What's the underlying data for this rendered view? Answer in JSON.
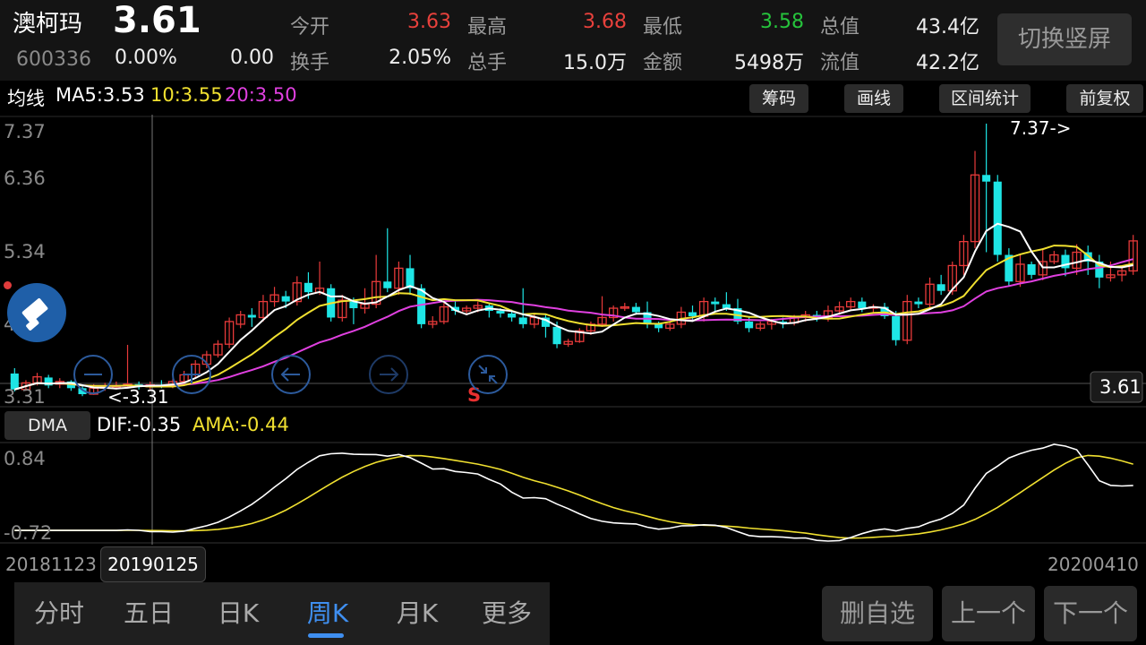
{
  "stock": {
    "name": "澳柯玛",
    "code": "600336",
    "price": "3.61",
    "change_pct": "0.00%",
    "change": "0.00"
  },
  "fields": [
    {
      "label": "今开",
      "value": "3.63",
      "color": "#e8413c"
    },
    {
      "label": "最高",
      "value": "3.68",
      "color": "#e8413c"
    },
    {
      "label": "最低",
      "value": "3.58",
      "color": "#26c43c"
    },
    {
      "label": "总值",
      "value": "43.4亿",
      "color": "#eeeeee"
    },
    {
      "label": "换手",
      "value": "2.05%",
      "color": "#eeeeee"
    },
    {
      "label": "总手",
      "value": "15.0万",
      "color": "#eeeeee"
    },
    {
      "label": "金额",
      "value": "5498万",
      "color": "#eeeeee"
    },
    {
      "label": "流值",
      "value": "42.2亿",
      "color": "#eeeeee"
    }
  ],
  "switch_label": "切换竖屏",
  "ma": {
    "title": "均线",
    "ma5": "MA5:3.53",
    "ma10": "10:3.55",
    "ma20": "20:3.50"
  },
  "chart_tools": [
    "筹码",
    "画线",
    "区间统计",
    "前复权"
  ],
  "dma": {
    "button": "DMA",
    "dif": "DIF:-0.35",
    "ama": "AMA:-0.44"
  },
  "dates": {
    "start": "20181123",
    "cursor": "20190125",
    "end": "20200410"
  },
  "tabs": [
    "分时",
    "五日",
    "日K",
    "周K",
    "月K",
    "更多"
  ],
  "active_tab": 3,
  "bottom_buttons": [
    "删自选",
    "上一个",
    "下一个"
  ],
  "chart_data": {
    "type": "candlestick",
    "price_ticks": [
      "7.37",
      "6.36",
      "5.34",
      "4.33",
      "3.31"
    ],
    "high_label": "7.37->",
    "low_label": "<-3.31",
    "current_price_label": "3.61",
    "signal_label": "S",
    "ylim": [
      3.31,
      7.37
    ],
    "candles": [
      [
        3.62,
        3.38,
        3.7,
        3.35
      ],
      [
        3.38,
        3.48,
        3.52,
        3.36
      ],
      [
        3.48,
        3.57,
        3.63,
        3.44
      ],
      [
        3.56,
        3.44,
        3.6,
        3.4
      ],
      [
        3.46,
        3.5,
        3.55,
        3.4
      ],
      [
        3.5,
        3.4,
        3.52,
        3.36
      ],
      [
        3.4,
        3.31,
        3.44,
        3.28
      ],
      [
        3.31,
        3.4,
        3.46,
        3.3
      ],
      [
        3.4,
        3.42,
        3.48,
        3.36
      ],
      [
        3.42,
        3.44,
        3.5,
        3.38
      ],
      [
        3.44,
        3.46,
        4.05,
        3.4
      ],
      [
        3.46,
        3.42,
        3.5,
        3.38
      ],
      [
        3.42,
        3.45,
        3.5,
        3.38
      ],
      [
        3.45,
        3.44,
        3.52,
        3.4
      ],
      [
        3.44,
        3.5,
        3.54,
        3.4
      ],
      [
        3.5,
        3.6,
        3.66,
        3.45
      ],
      [
        3.6,
        3.76,
        3.82,
        3.56
      ],
      [
        3.76,
        3.9,
        3.96,
        3.7
      ],
      [
        3.9,
        4.06,
        4.12,
        3.86
      ],
      [
        4.06,
        4.4,
        4.46,
        4.0
      ],
      [
        4.36,
        4.5,
        4.56,
        4.3
      ],
      [
        4.5,
        4.46,
        4.6,
        4.32
      ],
      [
        4.46,
        4.7,
        4.8,
        4.4
      ],
      [
        4.7,
        4.8,
        4.92,
        4.62
      ],
      [
        4.78,
        4.7,
        4.86,
        4.6
      ],
      [
        4.7,
        4.98,
        5.08,
        4.64
      ],
      [
        4.98,
        4.84,
        5.14,
        4.74
      ],
      [
        4.84,
        4.9,
        5.3,
        4.8
      ],
      [
        4.9,
        4.46,
        4.96,
        4.4
      ],
      [
        4.46,
        4.72,
        4.8,
        4.4
      ],
      [
        4.72,
        4.6,
        4.76,
        4.36
      ],
      [
        4.6,
        4.66,
        4.9,
        4.52
      ],
      [
        4.66,
        5.0,
        5.4,
        4.6
      ],
      [
        5.0,
        4.9,
        5.8,
        4.84
      ],
      [
        4.9,
        5.2,
        5.3,
        4.8
      ],
      [
        5.2,
        4.9,
        5.4,
        4.8
      ],
      [
        4.9,
        4.36,
        4.96,
        4.3
      ],
      [
        4.36,
        4.4,
        4.48,
        4.3
      ],
      [
        4.4,
        4.62,
        4.68,
        4.36
      ],
      [
        4.62,
        4.56,
        4.7,
        4.5
      ],
      [
        4.56,
        4.6,
        4.64,
        4.5
      ],
      [
        4.6,
        4.64,
        4.7,
        4.54
      ],
      [
        4.64,
        4.56,
        4.68,
        4.46
      ],
      [
        4.56,
        4.52,
        4.6,
        4.46
      ],
      [
        4.52,
        4.46,
        4.58,
        4.4
      ],
      [
        4.46,
        4.36,
        4.9,
        4.3
      ],
      [
        4.36,
        4.46,
        4.52,
        4.3
      ],
      [
        4.46,
        4.32,
        4.52,
        4.16
      ],
      [
        4.32,
        4.06,
        4.4,
        4.0
      ],
      [
        4.06,
        4.1,
        4.14,
        4.02
      ],
      [
        4.1,
        4.26,
        4.3,
        4.08
      ],
      [
        4.26,
        4.36,
        4.4,
        4.2
      ],
      [
        4.36,
        4.46,
        4.78,
        4.32
      ],
      [
        4.46,
        4.6,
        4.64,
        4.4
      ],
      [
        4.6,
        4.62,
        4.68,
        4.56
      ],
      [
        4.62,
        4.54,
        4.68,
        4.5
      ],
      [
        4.54,
        4.36,
        4.7,
        4.3
      ],
      [
        4.36,
        4.3,
        4.4,
        4.24
      ],
      [
        4.3,
        4.36,
        4.4,
        4.26
      ],
      [
        4.36,
        4.54,
        4.62,
        4.3
      ],
      [
        4.54,
        4.48,
        4.64,
        4.4
      ],
      [
        4.48,
        4.7,
        4.76,
        4.4
      ],
      [
        4.7,
        4.66,
        4.76,
        4.56
      ],
      [
        4.66,
        4.6,
        4.84,
        4.56
      ],
      [
        4.6,
        4.4,
        4.74,
        4.36
      ],
      [
        4.4,
        4.3,
        4.48,
        4.24
      ],
      [
        4.3,
        4.36,
        4.4,
        4.26
      ],
      [
        4.36,
        4.4,
        4.44,
        4.28
      ],
      [
        4.4,
        4.38,
        4.46,
        4.3
      ],
      [
        4.38,
        4.46,
        4.5,
        4.34
      ],
      [
        4.46,
        4.5,
        4.56,
        4.4
      ],
      [
        4.5,
        4.46,
        4.56,
        4.4
      ],
      [
        4.46,
        4.56,
        4.64,
        4.4
      ],
      [
        4.56,
        4.62,
        4.7,
        4.5
      ],
      [
        4.62,
        4.7,
        4.76,
        4.56
      ],
      [
        4.7,
        4.6,
        4.76,
        4.54
      ],
      [
        4.6,
        4.62,
        4.66,
        4.54
      ],
      [
        4.62,
        4.48,
        4.68,
        4.44
      ],
      [
        4.48,
        4.12,
        4.56,
        4.04
      ],
      [
        4.12,
        4.7,
        4.8,
        4.06
      ],
      [
        4.7,
        4.66,
        4.76,
        4.6
      ],
      [
        4.66,
        4.96,
        5.06,
        4.6
      ],
      [
        4.96,
        4.86,
        5.1,
        4.8
      ],
      [
        4.86,
        5.24,
        5.3,
        4.8
      ],
      [
        5.24,
        5.6,
        5.7,
        5.1
      ],
      [
        5.6,
        6.6,
        6.96,
        5.5
      ],
      [
        6.6,
        6.5,
        7.37,
        5.44
      ],
      [
        6.5,
        5.4,
        6.6,
        5.3
      ],
      [
        5.4,
        5.0,
        5.5,
        4.94
      ],
      [
        5.0,
        5.26,
        5.4,
        4.92
      ],
      [
        5.26,
        5.1,
        5.3,
        5.04
      ],
      [
        5.1,
        5.3,
        5.5,
        5.02
      ],
      [
        5.3,
        5.4,
        5.46,
        5.26
      ],
      [
        5.4,
        5.2,
        5.48,
        5.08
      ],
      [
        5.2,
        5.44,
        5.56,
        5.1
      ],
      [
        5.44,
        5.3,
        5.54,
        5.1
      ],
      [
        5.3,
        5.06,
        5.4,
        4.9
      ],
      [
        5.06,
        5.1,
        5.3,
        5.0
      ],
      [
        5.1,
        5.16,
        5.2,
        5.0
      ],
      [
        5.16,
        5.61,
        5.7,
        5.1
      ]
    ],
    "dma_ticks": [
      "0.84",
      "-0.72"
    ],
    "dma_ylim": [
      -0.72,
      0.84
    ]
  }
}
